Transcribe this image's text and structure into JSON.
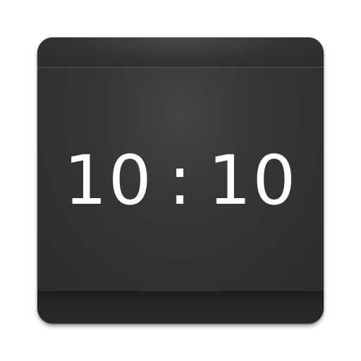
{
  "icon": {
    "hours": "10",
    "separator": ":",
    "minutes": "10"
  },
  "colors": {
    "background": "#ffffff",
    "icon_body": "#2f2f2f",
    "digits": "#ffffff"
  }
}
